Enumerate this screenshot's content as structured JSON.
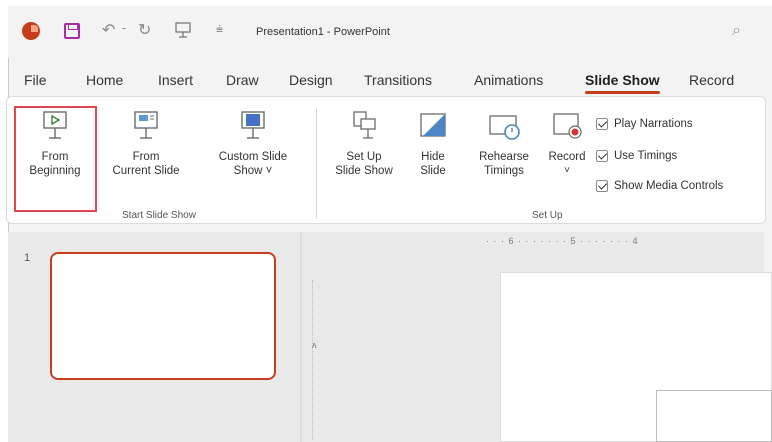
{
  "titlebar": {
    "document_title": "Presentation1 - PowerPoint",
    "icons": [
      "powerpoint-logo",
      "save-icon",
      "undo-icon",
      "redo-icon",
      "present-icon",
      "customize-icon",
      "search-icon"
    ]
  },
  "tabs": [
    {
      "label": "File"
    },
    {
      "label": "Home"
    },
    {
      "label": "Insert"
    },
    {
      "label": "Draw"
    },
    {
      "label": "Design"
    },
    {
      "label": "Transitions"
    },
    {
      "label": "Animations"
    },
    {
      "label": "Slide Show",
      "active": true
    },
    {
      "label": "Record"
    }
  ],
  "ribbon": {
    "start_group": {
      "label": "Start Slide Show",
      "from_beginning": {
        "line1": "From",
        "line2": "Beginning"
      },
      "from_current": {
        "line1": "From",
        "line2": "Current Slide"
      },
      "custom_show": {
        "line1": "Custom Slide",
        "line2": "Show ˅"
      }
    },
    "setup_group": {
      "label": "Set Up",
      "setup_show": {
        "line1": "Set Up",
        "line2": "Slide Show"
      },
      "hide_slide": {
        "line1": "Hide",
        "line2": "Slide"
      },
      "rehearse": {
        "line1": "Rehearse",
        "line2": "Timings"
      },
      "record": {
        "line1": "Record",
        "line2": "˅"
      },
      "checkboxes": [
        {
          "label": "Play Narrations",
          "checked": true
        },
        {
          "label": "Use Timings",
          "checked": true
        },
        {
          "label": "Show Media Controls",
          "checked": true
        }
      ]
    }
  },
  "slides_pane": {
    "slide_number": "1"
  },
  "ruler": {
    "top_text": "· · · 6 · · · · · · · 5 · · · · · · · 4",
    "left_mark": "ʌ"
  },
  "colors": {
    "accent": "#c43e1c",
    "highlight": "#e0474c"
  }
}
